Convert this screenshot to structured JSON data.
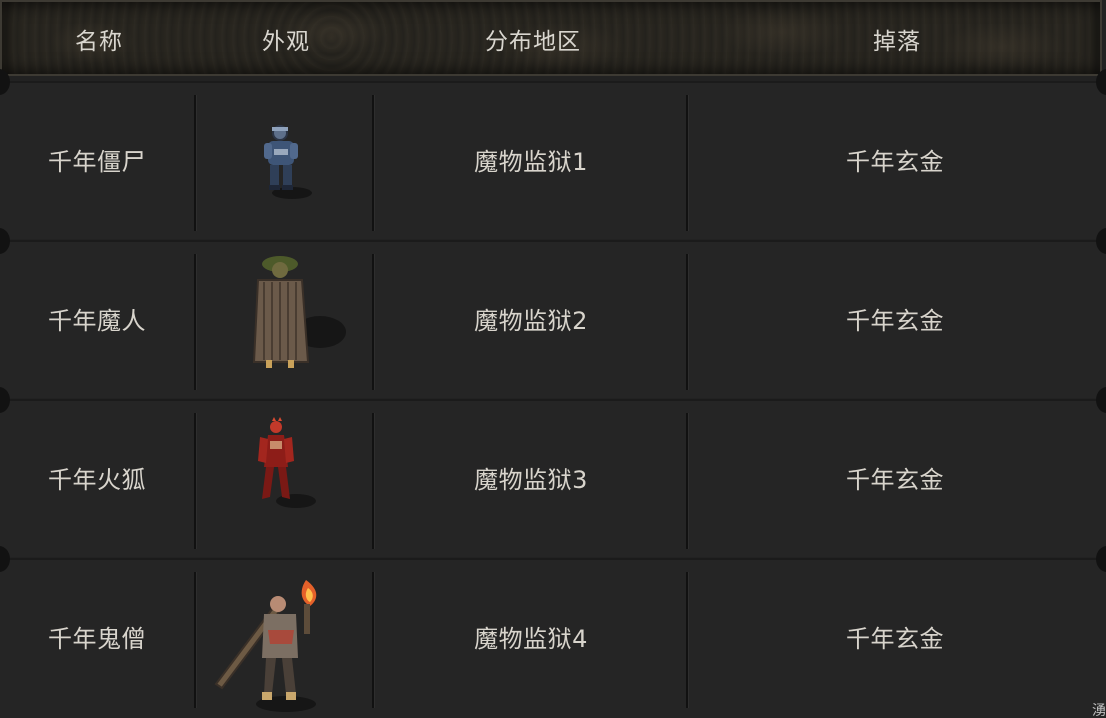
{
  "header": {
    "col_name": "名称",
    "col_appearance": "外观",
    "col_area": "分布地区",
    "col_drop": "掉落"
  },
  "rows": [
    {
      "name": "千年僵尸",
      "area": "魔物监狱1",
      "drop": "千年玄金",
      "appearance_icon": "zombie-icon"
    },
    {
      "name": "千年魔人",
      "area": "魔物监狱2",
      "drop": "千年玄金",
      "appearance_icon": "demon-icon"
    },
    {
      "name": "千年火狐",
      "area": "魔物监狱3",
      "drop": "千年玄金",
      "appearance_icon": "fire-fox-icon"
    },
    {
      "name": "千年鬼僧",
      "area": "魔物监狱4",
      "drop": "千年玄金",
      "appearance_icon": "ghost-monk-icon"
    }
  ],
  "corner_glyph": "湧",
  "colors": {
    "background": "#222222",
    "header_bg": "#26241f",
    "text": "#d8d4cc"
  }
}
